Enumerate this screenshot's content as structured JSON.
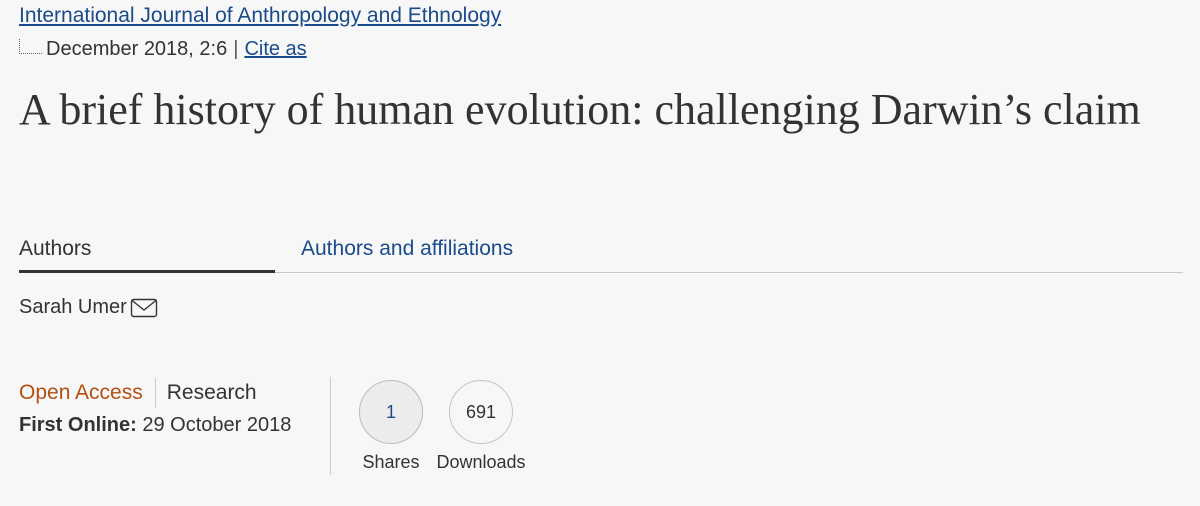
{
  "header": {
    "journal": "International Journal of Anthropology and Ethnology",
    "date_issue": "December 2018, 2:6",
    "separator": "|",
    "cite_as": "Cite as"
  },
  "article": {
    "title": "A brief history of human evolution: challenging Darwin’s claim"
  },
  "tabs": [
    {
      "label": "Authors",
      "active": true
    },
    {
      "label": "Authors and affiliations",
      "active": false
    }
  ],
  "author": {
    "name": "Sarah Umer",
    "icon": "envelope-icon"
  },
  "info": {
    "access": "Open Access",
    "type": "Research",
    "first_online_label": "First Online:",
    "first_online_date": "29 October 2018"
  },
  "metrics": {
    "shares_value": "1",
    "shares_label": "Shares",
    "downloads_value": "691",
    "downloads_label": "Downloads"
  },
  "colors": {
    "link": "#1a4b8a",
    "open_access": "#b24f12",
    "background": "#f7f7f7"
  }
}
